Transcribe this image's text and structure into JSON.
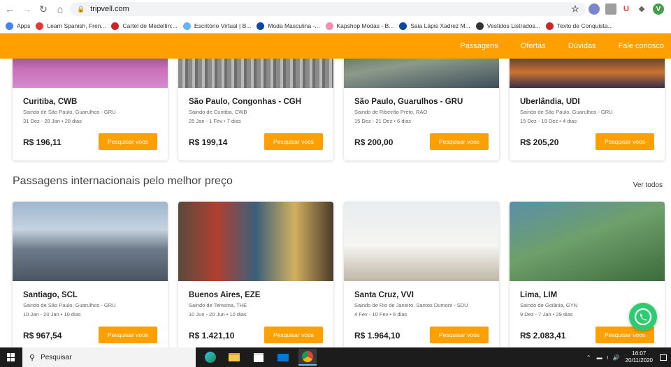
{
  "browser": {
    "url": "tripvell.com",
    "bookmarks": [
      {
        "label": "Apps",
        "color": "#4285f4"
      },
      {
        "label": "Learn Spanish, Fren...",
        "color": "#e53935"
      },
      {
        "label": "Cartel de Medellín:...",
        "color": "#c62828"
      },
      {
        "label": "Escritório Virtual | B...",
        "color": "#64b5f6"
      },
      {
        "label": "Moda Masculina -...",
        "color": "#0d47a1"
      },
      {
        "label": "Kapshop Modas - B...",
        "color": "#f48fb1"
      },
      {
        "label": "Saia Lápis Xadrez M...",
        "color": "#0d47a1"
      },
      {
        "label": "Vestidos Listrados...",
        "color": "#333333"
      },
      {
        "label": "Texto de Conquista...",
        "color": "#c62828"
      }
    ],
    "profile_initial": "V"
  },
  "nav": {
    "items": [
      "Passagens",
      "Ofertas",
      "Dúvidas",
      "Fale conosco"
    ]
  },
  "domestic": [
    {
      "city": "Curitiba, CWB",
      "from": "Saindo de São Paulo, Guarulhos - GRU",
      "dates": "31 Dez - 28 Jan • 28 dias",
      "price": "R$ 196,11",
      "button": "Pesquisar voos"
    },
    {
      "city": "São Paulo, Congonhas - CGH",
      "from": "Saindo de Curitiba, CWB",
      "dates": "25 Jan - 1 Fev • 7 dias",
      "price": "R$ 199,14",
      "button": "Pesquisar voos"
    },
    {
      "city": "São Paulo, Guarulhos - GRU",
      "from": "Saindo de Ribeirão Preto, RAO",
      "dates": "15 Dez - 21 Dez • 6 dias",
      "price": "R$ 200,00",
      "button": "Pesquisar voos"
    },
    {
      "city": "Uberlândia, UDI",
      "from": "Saindo de São Paulo, Guarulhos - GRU",
      "dates": "15 Dez - 19 Dez • 4 dias",
      "price": "R$ 205,20",
      "button": "Pesquisar voos"
    }
  ],
  "international_section": {
    "title": "Passagens internacionais pelo melhor preço",
    "see_all": "Ver todos"
  },
  "international": [
    {
      "city": "Santiago, SCL",
      "from": "Saindo de São Paulo, Guarulhos - GRU",
      "dates": "10 Jan - 20 Jan • 10 dias",
      "price": "R$ 967,54",
      "button": "Pesquisar voos"
    },
    {
      "city": "Buenos Aires, EZE",
      "from": "Saindo de Teresina, THE",
      "dates": "10 Jun - 20 Jun • 10 dias",
      "price": "R$ 1.421,10",
      "button": "Pesquisar voos"
    },
    {
      "city": "Santa Cruz, VVI",
      "from": "Saindo de Rio de Janeiro, Santos Dumont - SDU",
      "dates": "4 Fev - 10 Fev • 6 dias",
      "price": "R$ 1.964,10",
      "button": "Pesquisar voos"
    },
    {
      "city": "Lima, LIM",
      "from": "Saindo de Goiânia, GYN",
      "dates": "9 Dez - 7 Jan • 29 dias",
      "price": "R$ 2.083,41",
      "button": "Pesquisar voos"
    }
  ],
  "taskbar": {
    "search_placeholder": "Pesquisar",
    "time": "16:07",
    "date": "20/11/2020"
  }
}
